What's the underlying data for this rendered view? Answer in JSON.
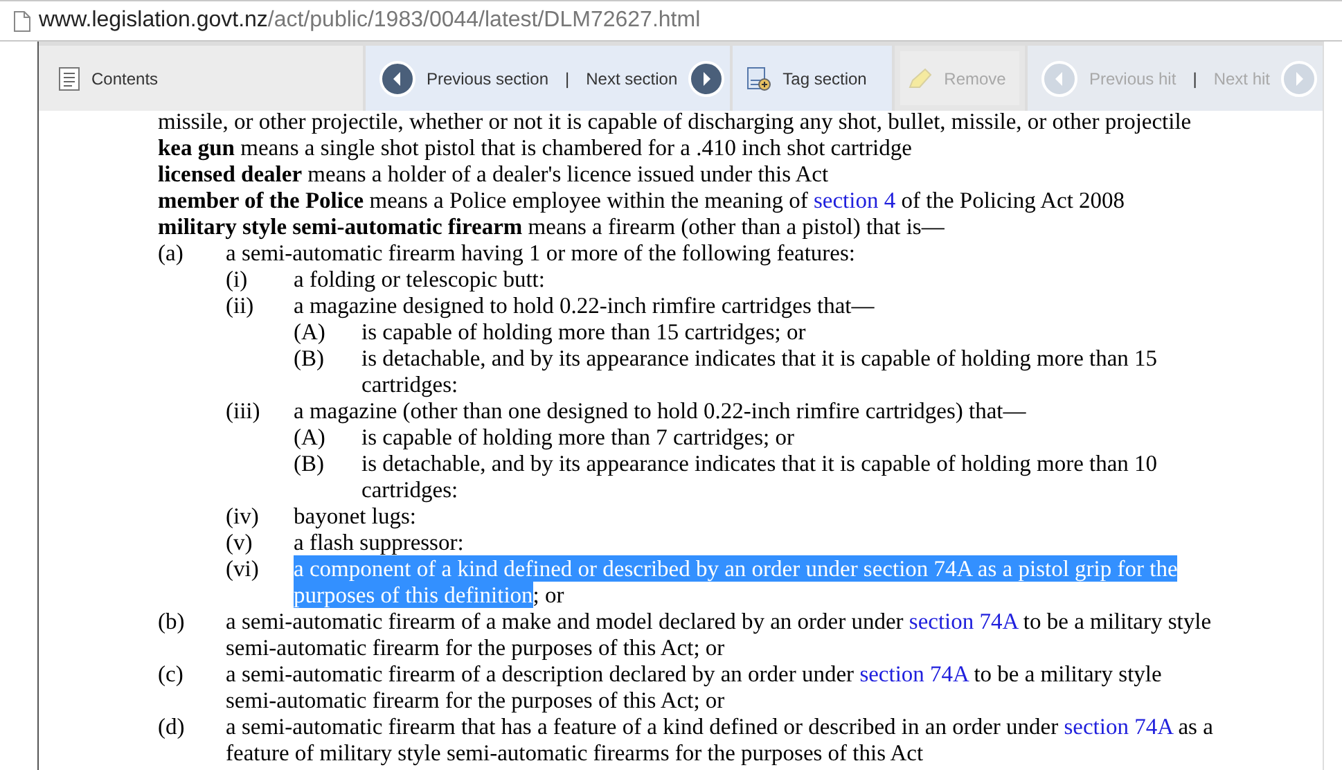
{
  "address_bar": {
    "domain": "www.legislation.govt.nz",
    "path": "/act/public/1983/0044/latest/DLM72627.html"
  },
  "toolbar": {
    "contents": {
      "label": "Contents"
    },
    "section_nav": {
      "previous": "Previous section",
      "separator": "|",
      "next": "Next section"
    },
    "tag": {
      "label": "Tag section"
    },
    "remove": {
      "label": "Remove",
      "disabled": true
    },
    "hit_nav": {
      "previous": "Previous hit",
      "separator": "|",
      "next": "Next hit",
      "disabled": true
    }
  },
  "definitions": [
    {
      "text": "missile, or other projectile, whether or not it is capable of discharging any shot, bullet, missile, or other projectile"
    },
    {
      "text": "**kea gun** means a single shot pistol that is chambered for a .410 inch shot cartridge"
    },
    {
      "text": "**licensed dealer** means a holder of a dealer's licence issued under this Act"
    },
    {
      "text": "**member of the Police** means a Police employee within the meaning of",
      "link": "section 4",
      "after": "of the Policing Act 2008"
    },
    {
      "text": "**military style semi-automatic firearm** means a firearm (other than a pistol) that is—"
    }
  ],
  "paragraphs": [
    {
      "label": "(a)",
      "text": "a semi-automatic firearm having 1 or more of the following features:",
      "children": [
        {
          "label": "(i)",
          "text": "a folding or telescopic butt:"
        },
        {
          "label": "(ii)",
          "text": "a magazine designed to hold 0.22-inch rimfire cartridges that—",
          "children": [
            {
              "label": "(A)",
              "text": "is capable of holding more than 15 cartridges; or"
            },
            {
              "label": "(B)",
              "text": "is detachable, and by its appearance indicates that it is capable of holding more than 15 cartridges:"
            }
          ]
        },
        {
          "label": "(iii)",
          "text": "a magazine (other than one designed to hold 0.22-inch rimfire cartridges) that—",
          "children": [
            {
              "label": "(A)",
              "text": "is capable of holding more than 7 cartridges; or"
            },
            {
              "label": "(B)",
              "text": "is detachable, and by its appearance indicates that it is capable of holding more than 10 cartridges:"
            }
          ]
        },
        {
          "label": "(iv)",
          "text": "bayonet lugs:"
        },
        {
          "label": "(v)",
          "text": "a flash suppressor:"
        },
        {
          "label": "(vi)",
          "text": "a component of a kind defined or described by an order under section 74A as a pistol grip for the purposes of this definition",
          "after": "; or",
          "highlighted": true
        }
      ]
    },
    {
      "label": "(b)",
      "text": "a semi-automatic firearm of a make and model declared by an order under",
      "link": "section 74A",
      "after": "to be a military style semi-automatic firearm for the purposes of this Act; or"
    },
    {
      "label": "(c)",
      "text": "a semi-automatic firearm of a description declared by an order under",
      "link": "section 74A",
      "after": "to be a military style semi-automatic firearm for the purposes of this Act; or"
    },
    {
      "label": "(d)",
      "text": "a semi-automatic firearm that has a feature of a kind defined or described in an order under",
      "link": "section 74A",
      "after": "as a feature of military style semi-automatic firearms for the purposes of this Act"
    }
  ]
}
